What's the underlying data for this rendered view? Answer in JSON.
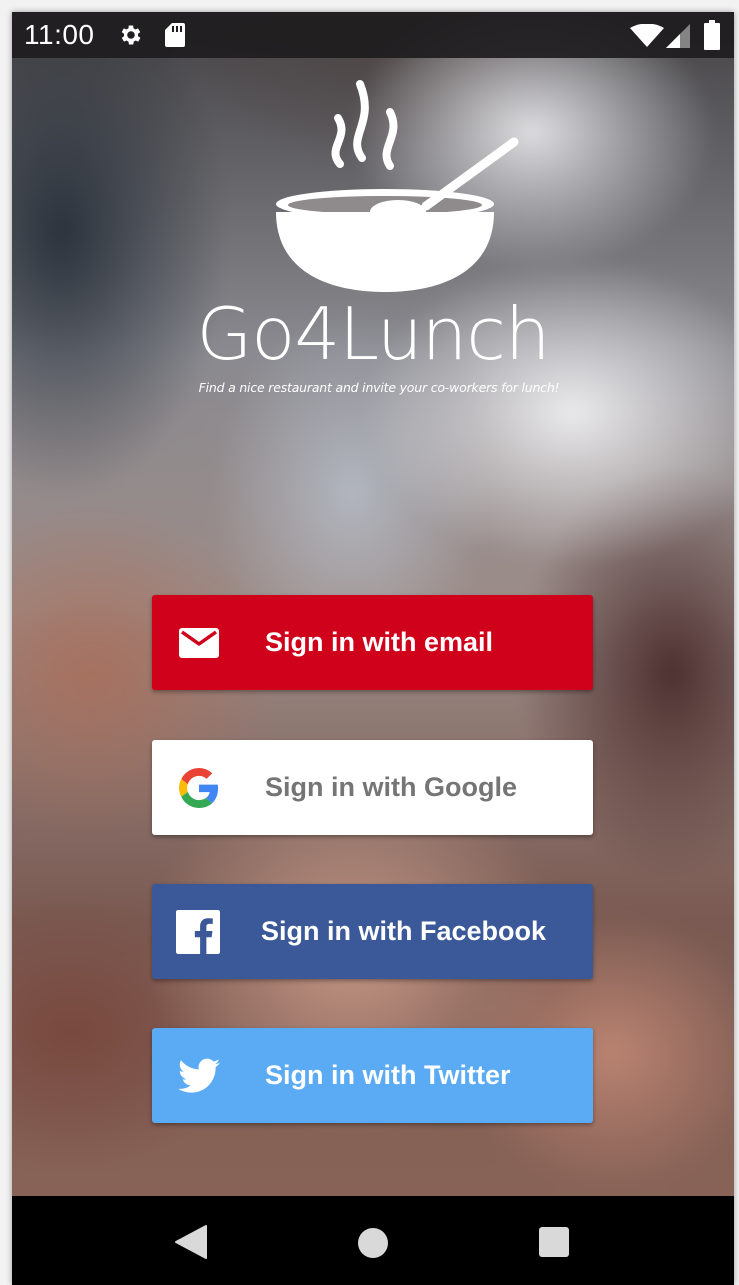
{
  "status_bar": {
    "time": "11:00",
    "icons": [
      "gear-icon",
      "sd-card-icon",
      "wifi-icon",
      "signal-icon",
      "battery-icon"
    ]
  },
  "header": {
    "app_title": "Go4Lunch",
    "tagline": "Find a nice restaurant and invite your co-workers for lunch!",
    "logo_icon": "soup-bowl-icon"
  },
  "sign_in_buttons": [
    {
      "label": "Sign in with email",
      "icon": "mail-icon",
      "color": "#d0021b"
    },
    {
      "label": "Sign in with Google",
      "icon": "google-icon",
      "color": "#ffffff"
    },
    {
      "label": "Sign in with Facebook",
      "icon": "facebook-icon",
      "color": "#3b5998"
    },
    {
      "label": "Sign in with Twitter",
      "icon": "twitter-icon",
      "color": "#5baaf4"
    }
  ],
  "nav_bar": {
    "icons": [
      "back-icon",
      "home-icon",
      "recents-icon"
    ]
  }
}
